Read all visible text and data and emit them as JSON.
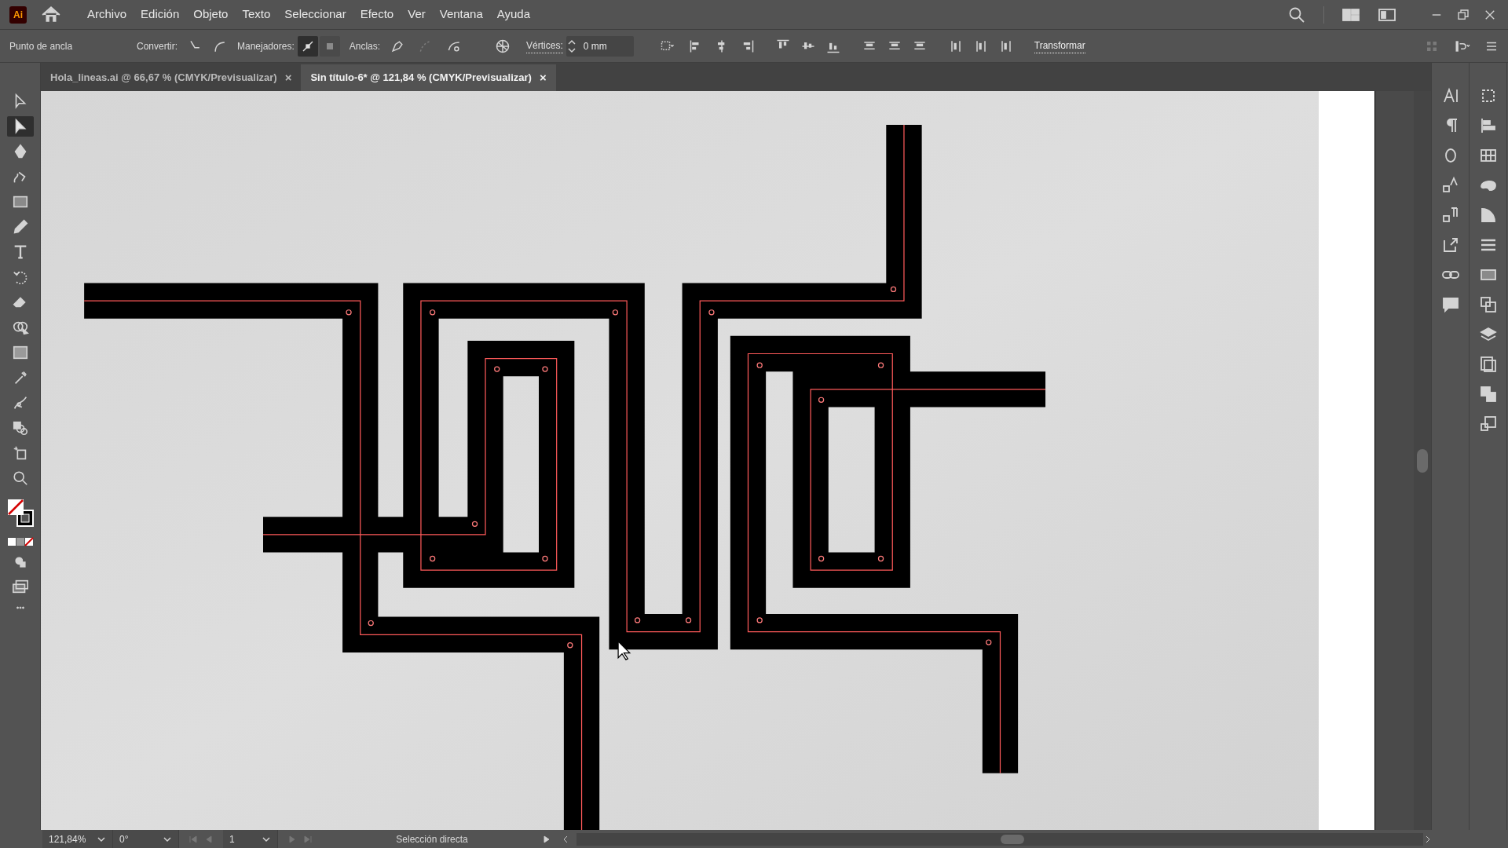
{
  "menu": [
    "Archivo",
    "Edición",
    "Objeto",
    "Texto",
    "Seleccionar",
    "Efecto",
    "Ver",
    "Ventana",
    "Ayuda"
  ],
  "app_badge": "Ai",
  "control_bar": {
    "selection_label": "Punto de ancla",
    "convert_label": "Convertir:",
    "handles_label": "Manejadores:",
    "handle_buttons": [
      {
        "selected": true
      },
      {
        "selected": false
      }
    ],
    "anchors_label": "Anclas:",
    "corners_label": "Vértices:",
    "corners_value": "0 mm",
    "transform_link": "Transformar"
  },
  "tabs": [
    {
      "label": "Hola_lineas.ai @ 66,67 % (CMYK/Previsualizar)",
      "close": "×",
      "selected": false
    },
    {
      "label": "Sin título-6* @ 121,84 % (CMYK/Previsualizar)",
      "close": "×",
      "selected": true
    }
  ],
  "tools": [
    {
      "kind": "selection",
      "selected": false
    },
    {
      "kind": "direct",
      "selected": true
    },
    {
      "kind": "pen",
      "selected": false
    },
    {
      "kind": "curvature",
      "selected": false
    },
    {
      "kind": "rect",
      "selected": false
    },
    {
      "kind": "pencil",
      "selected": false
    },
    {
      "kind": "type",
      "selected": false
    },
    {
      "kind": "rotate",
      "selected": false
    },
    {
      "kind": "eraser",
      "selected": false
    },
    {
      "kind": "builder",
      "selected": false
    },
    {
      "kind": "gradient",
      "selected": false
    },
    {
      "kind": "eyedropper",
      "selected": false
    },
    {
      "kind": "puppet",
      "selected": false
    },
    {
      "kind": "blend",
      "selected": false
    },
    {
      "kind": "artboard",
      "selected": false
    },
    {
      "kind": "zoom",
      "selected": false
    }
  ],
  "status_bar": {
    "zoom": "121,84%",
    "rotation": "0°",
    "artboard": "1",
    "tool": "Selección directa"
  }
}
